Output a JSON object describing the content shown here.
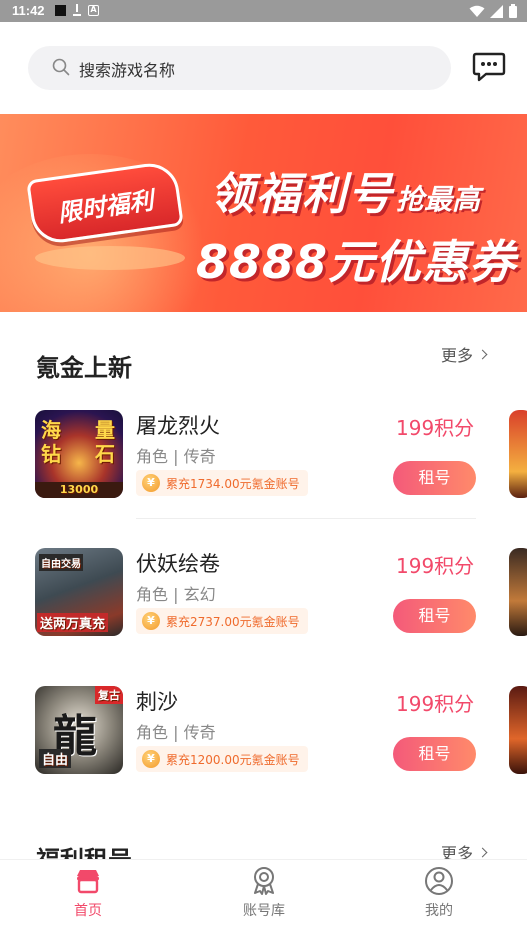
{
  "status_bar": {
    "time": "11:42"
  },
  "search": {
    "placeholder": "搜索游戏名称"
  },
  "banner": {
    "tag": "限时福利",
    "headline_big": "领福利号",
    "headline_small": "抢最高",
    "line2": "8888元优惠券"
  },
  "section_new": {
    "title": "氪金上新",
    "more_label": "更多"
  },
  "games": [
    {
      "name": "屠龙烈火",
      "tags": "角色 | 传奇",
      "recharge": "累充1734.00元氪金账号",
      "price": "199积分",
      "rent_label": "租号",
      "thumb_text_a": "海",
      "thumb_text_b": "量",
      "thumb_text_c": "钻",
      "thumb_text_d": "石",
      "thumb_footer": "13000"
    },
    {
      "name": "伏妖绘卷",
      "tags": "角色 | 玄幻",
      "recharge": "累充2737.00元氪金账号",
      "price": "199积分",
      "rent_label": "租号",
      "thumb_text_a": "自由交易",
      "thumb_text_b": "送两万真充"
    },
    {
      "name": "刺沙",
      "tags": "角色 | 传奇",
      "recharge": "累充1200.00元氪金账号",
      "price": "199积分",
      "rent_label": "租号",
      "thumb_text_a": "龍",
      "thumb_text_b": "复古",
      "thumb_text_c": "自由"
    }
  ],
  "section_welfare": {
    "title": "福利租号",
    "more_label": "更多"
  },
  "tab_bar": {
    "tabs": [
      {
        "label": "首页",
        "icon": "shop-icon",
        "active": true
      },
      {
        "label": "账号库",
        "icon": "badge-icon",
        "active": false
      },
      {
        "label": "我的",
        "icon": "user-icon",
        "active": false
      }
    ]
  },
  "colors": {
    "accent": "#f2496a",
    "banner": "#ff5a3a",
    "recharge_text": "#ef6b2d"
  }
}
